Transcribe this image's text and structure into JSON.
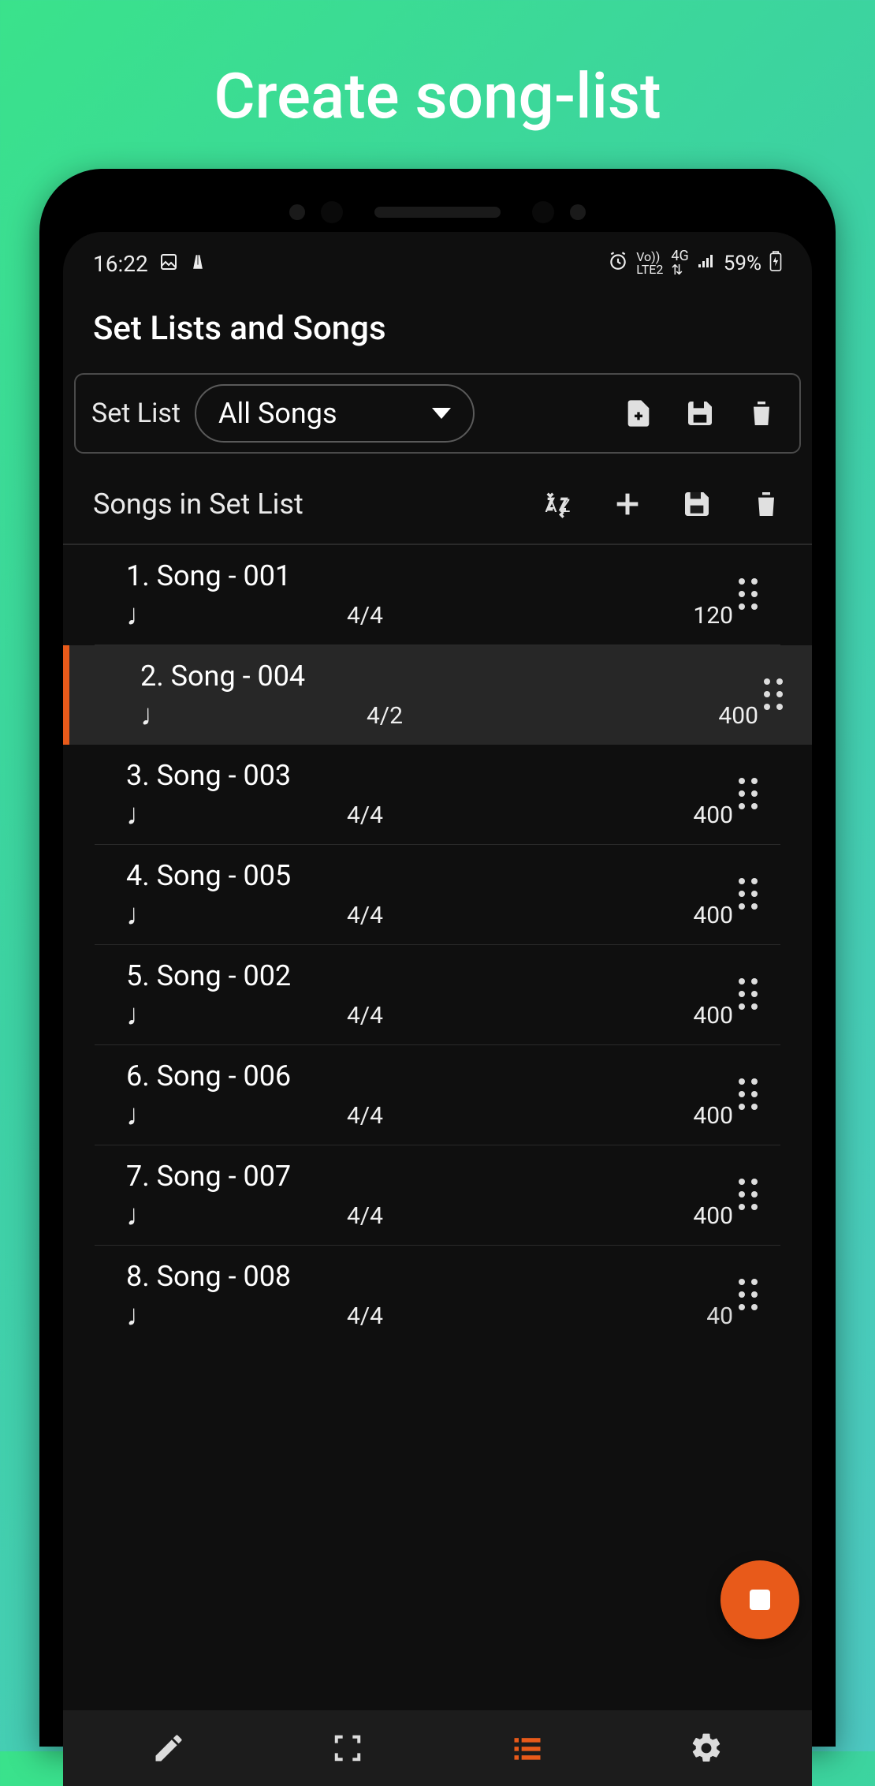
{
  "hero": {
    "title": "Create song-list"
  },
  "status": {
    "time": "16:22",
    "battery": "59%",
    "network_label": "4G",
    "lte_label": "LTE2",
    "volte_label": "Vo))"
  },
  "header": {
    "title": "Set Lists and Songs"
  },
  "setlist": {
    "label": "Set List",
    "dropdown_value": "All Songs"
  },
  "songs_header": {
    "title": "Songs in Set List"
  },
  "songs": [
    {
      "num": "1.",
      "name": "Song - 001",
      "sig": "4/4",
      "tempo": "120",
      "selected": false
    },
    {
      "num": "2.",
      "name": "Song - 004",
      "sig": "4/2",
      "tempo": "400",
      "selected": true
    },
    {
      "num": "3.",
      "name": "Song - 003",
      "sig": "4/4",
      "tempo": "400",
      "selected": false
    },
    {
      "num": "4.",
      "name": "Song - 005",
      "sig": "4/4",
      "tempo": "400",
      "selected": false
    },
    {
      "num": "5.",
      "name": "Song - 002",
      "sig": "4/4",
      "tempo": "400",
      "selected": false
    },
    {
      "num": "6.",
      "name": "Song - 006",
      "sig": "4/4",
      "tempo": "400",
      "selected": false
    },
    {
      "num": "7.",
      "name": "Song - 007",
      "sig": "4/4",
      "tempo": "400",
      "selected": false
    },
    {
      "num": "8.",
      "name": "Song - 008",
      "sig": "4/4",
      "tempo": "40",
      "selected": false
    }
  ],
  "icons": {
    "note": "♩"
  }
}
